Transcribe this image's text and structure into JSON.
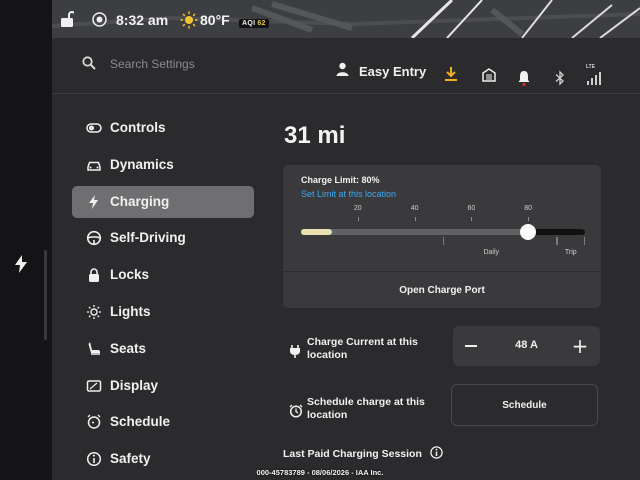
{
  "status_bar": {
    "time": "8:32 am",
    "temperature": "80°F",
    "aqi_label": "AQI",
    "aqi_value": "62"
  },
  "header": {
    "search_placeholder": "Search Settings",
    "profile_name": "Easy Entry",
    "signal_label": "LTE"
  },
  "sidebar": {
    "items": [
      {
        "label": "Controls",
        "icon": "toggle-icon",
        "active": false
      },
      {
        "label": "Dynamics",
        "icon": "car-icon",
        "active": false
      },
      {
        "label": "Charging",
        "icon": "bolt-icon",
        "active": true
      },
      {
        "label": "Self-Driving",
        "icon": "steering-wheel-icon",
        "active": false
      },
      {
        "label": "Locks",
        "icon": "lock-icon",
        "active": false
      },
      {
        "label": "Lights",
        "icon": "sun-icon",
        "active": false
      },
      {
        "label": "Seats",
        "icon": "seat-icon",
        "active": false
      },
      {
        "label": "Display",
        "icon": "display-icon",
        "active": false
      },
      {
        "label": "Schedule",
        "icon": "alarm-clock-icon",
        "active": false
      },
      {
        "label": "Safety",
        "icon": "info-circle-icon",
        "active": false
      }
    ]
  },
  "charging": {
    "range": "31 mi",
    "charge_limit_label": "Charge Limit: 80%",
    "charge_limit_percent": 80,
    "current_charge_percent": 11,
    "set_limit_link": "Set Limit at this location",
    "ticks": [
      "20",
      "40",
      "60",
      "80"
    ],
    "daily_label": "Daily",
    "trip_label": "Trip",
    "open_port_label": "Open Charge Port",
    "current_label": "Charge Current at this location",
    "current_value": "48 A",
    "schedule_label": "Schedule charge at this location",
    "schedule_button": "Schedule",
    "last_session_label": "Last Paid Charging Session"
  },
  "watermark": "000-45783789 - 08/06/2026 - IAA Inc.",
  "colors": {
    "link": "#3ea8f0",
    "download": "#f0b020",
    "bell_dot": "#e03030",
    "active_nav": "#6f6f72",
    "charge_fill": "#e9dfb0"
  }
}
